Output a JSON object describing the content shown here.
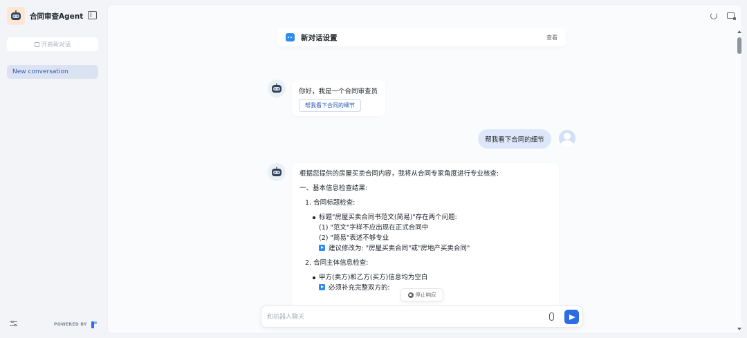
{
  "app": {
    "title": "合同审查Agent"
  },
  "sidebar": {
    "new_chat_label": "开启新对话",
    "conversations": [
      {
        "label": "New conversation"
      }
    ],
    "powered_by": "POWERED BY"
  },
  "header": {
    "title": "新对话设置",
    "view_label": "查看"
  },
  "chat": {
    "bot_greeting": "你好，我是一个合同审查员",
    "suggestion": "帮我看下合同的细节",
    "user_message": "帮我看下合同的细节",
    "answer": {
      "intro": "根据您提供的房屋买卖合同内容，我将从合同专家角度进行专业核查:",
      "section1": "一、基本信息检查结果:",
      "item1_title": "1. 合同标题检查:",
      "item1_bullet": "标题\"房屋买卖合同书范文(简易)\"存在两个问题:",
      "item1_point1": "(1) \"范文\"字样不应出现在正式合同中",
      "item1_point2": "(2) \"简易\"表述不够专业",
      "item1_suggest": "建议修改为: \"房屋买卖合同\"或\"房地产买卖合同\"",
      "item2_title": "2. 合同主体信息检查:",
      "item2_bullet": "甲方(卖方)和乙方(买方)信息均为空白",
      "item2_suggest": "必须补充完整双方的:"
    },
    "stop_label": "停止响应"
  },
  "input": {
    "placeholder": "和机器人聊天"
  },
  "colors": {
    "accent": "#2e6ce6",
    "conversation_active_bg": "#dbe3f2",
    "user_bubble_bg": "#dde7f9"
  }
}
